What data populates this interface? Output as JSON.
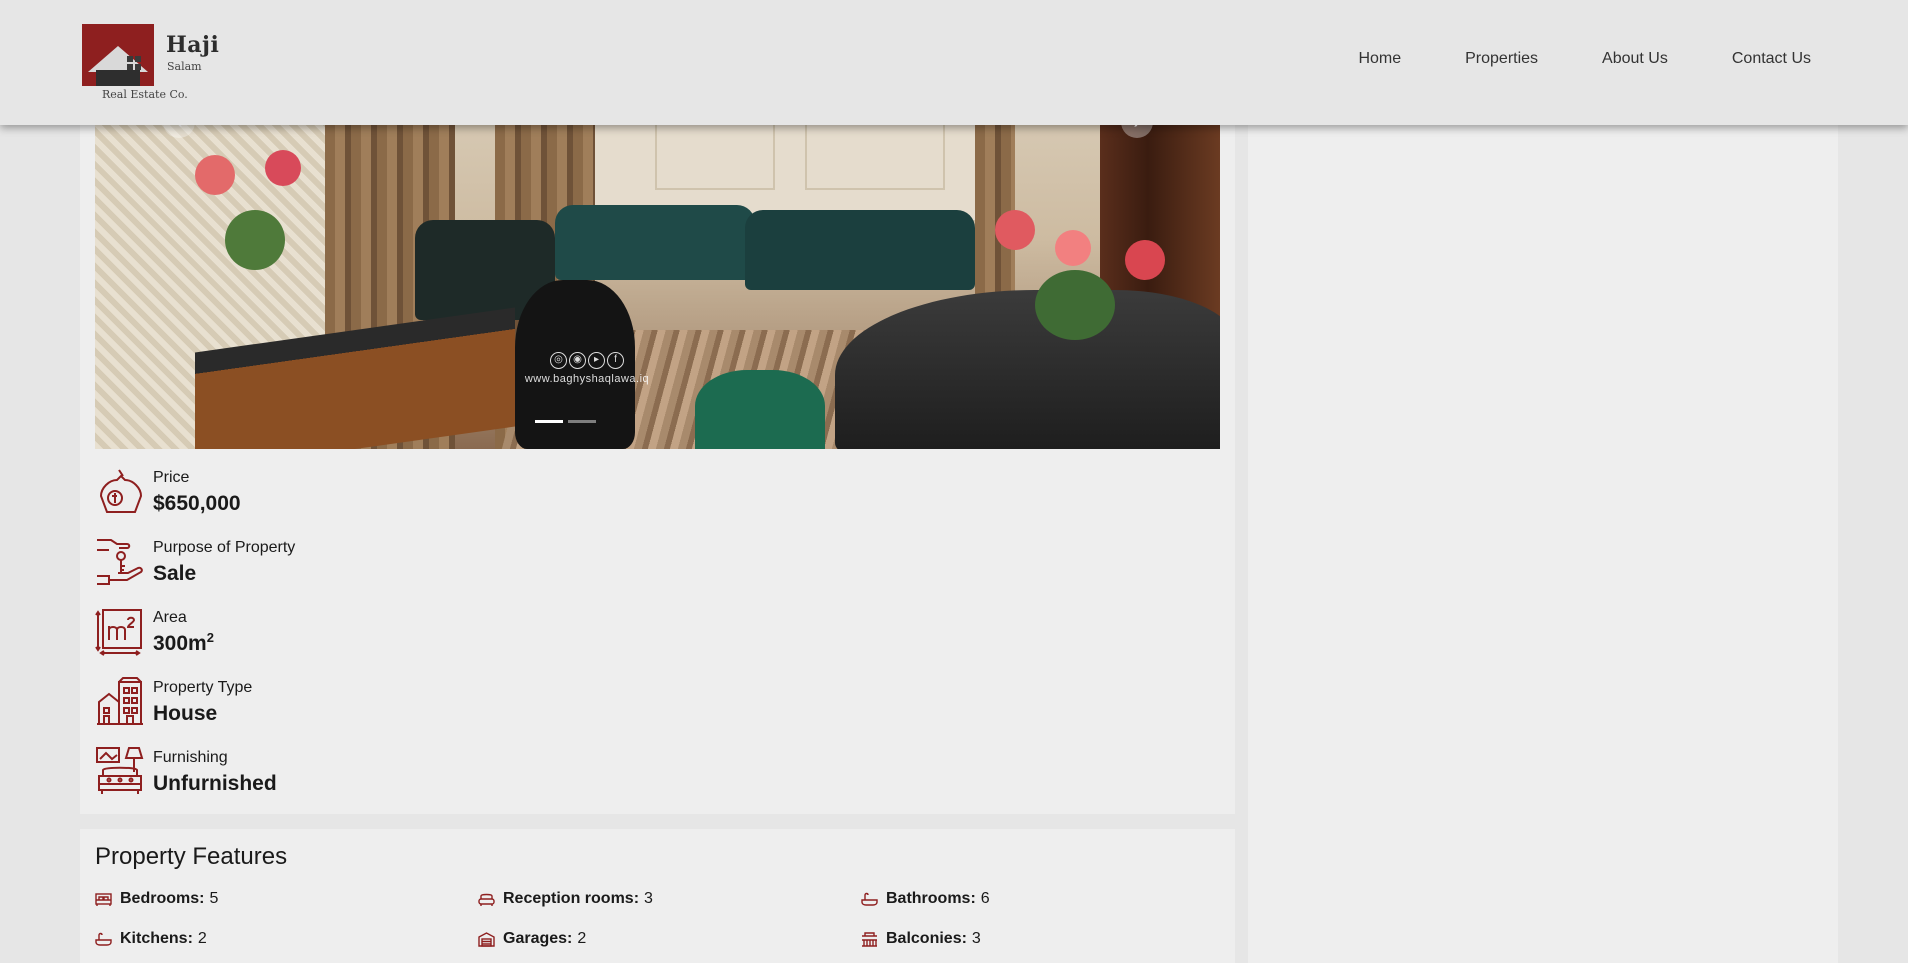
{
  "brand": {
    "name": "Haji",
    "sub": "Salam",
    "tagline": "Real Estate Co."
  },
  "nav": {
    "items": [
      "Home",
      "Properties",
      "About Us",
      "Contact Us"
    ]
  },
  "gallery": {
    "watermark_url": "www.baghyshaqlawa.iq",
    "watermark_icons": [
      "globe-icon",
      "instagram-icon",
      "youtube-icon",
      "facebook-icon"
    ],
    "slide_count": 2,
    "active_slide": 1,
    "prev_icon": "chevron-left-icon",
    "next_icon": "chevron-right-icon"
  },
  "details": {
    "price": {
      "label": "Price",
      "value": "$650,000",
      "icon": "money-bag-icon"
    },
    "purpose": {
      "label": "Purpose of Property",
      "value": "Sale",
      "icon": "hand-key-icon"
    },
    "area": {
      "label": "Area",
      "value": "300m",
      "unit_sup": "2",
      "icon": "area-m2-icon"
    },
    "type": {
      "label": "Property Type",
      "value": "House",
      "icon": "buildings-icon"
    },
    "furnishing": {
      "label": "Furnishing",
      "value": "Unfurnished",
      "icon": "furniture-icon"
    }
  },
  "features": {
    "title": "Property Features",
    "items": [
      {
        "label": "Bedrooms:",
        "value": "5",
        "icon": "bed-icon"
      },
      {
        "label": "Reception rooms:",
        "value": "3",
        "icon": "sofa-icon"
      },
      {
        "label": "Bathrooms:",
        "value": "6",
        "icon": "bathtub-icon"
      },
      {
        "label": "Kitchens:",
        "value": "2",
        "icon": "kitchen-icon"
      },
      {
        "label": "Garages:",
        "value": "2",
        "icon": "garage-icon"
      },
      {
        "label": "Balconies:",
        "value": "3",
        "icon": "balcony-icon"
      }
    ]
  },
  "colors": {
    "accent": "#8e1f1f",
    "background": "#e6e6e6",
    "panel": "#eeeeee"
  }
}
